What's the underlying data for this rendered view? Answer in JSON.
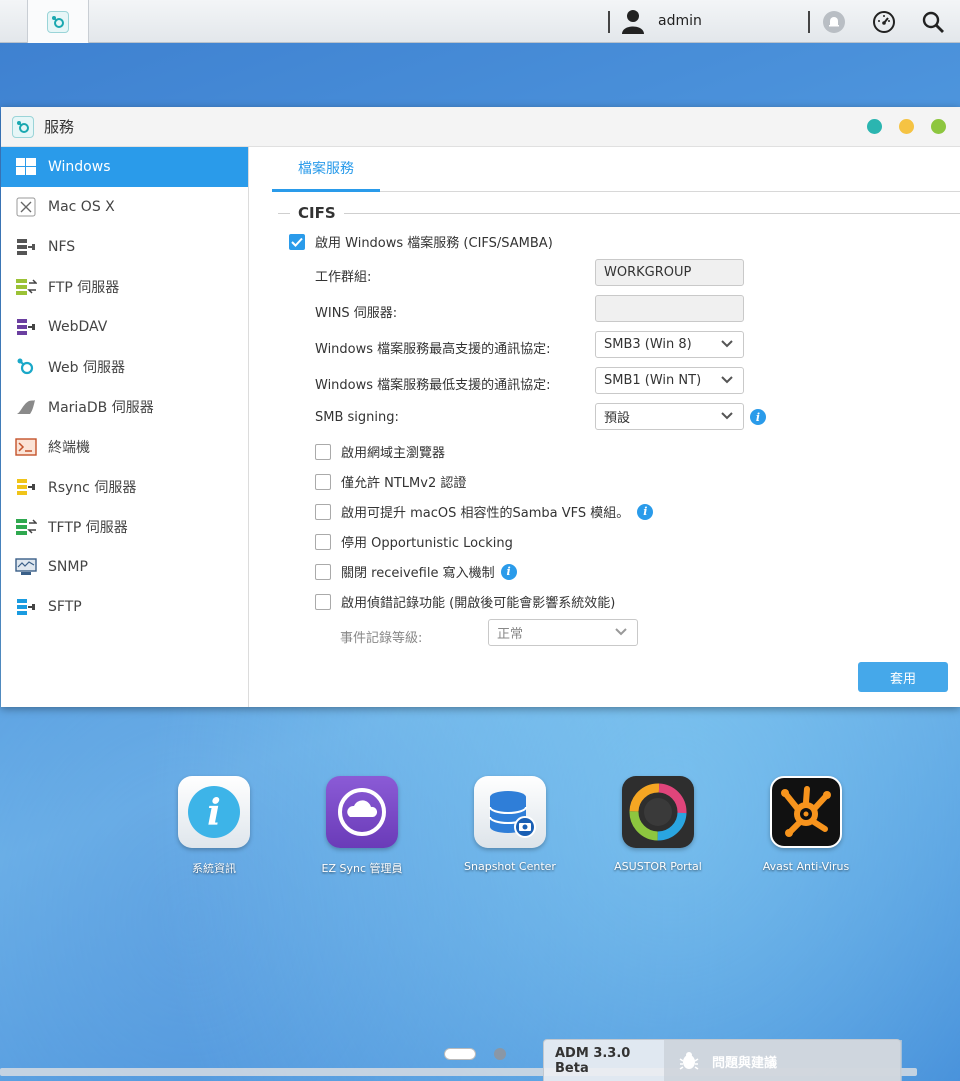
{
  "topbar": {
    "user_name": "admin",
    "icons": [
      "app-logo-icon",
      "user-icon",
      "notification-bell-icon",
      "dashboard-icon",
      "search-icon"
    ]
  },
  "window": {
    "title": "服務",
    "controls": {
      "colors": [
        "#2bb5b0",
        "#f5c343",
        "#8dc63f"
      ]
    }
  },
  "sidebar": {
    "items": [
      {
        "label": "Windows",
        "icon": "windows-icon",
        "active": true
      },
      {
        "label": "Mac OS X",
        "icon": "mac-os-x-icon"
      },
      {
        "label": "NFS",
        "icon": "nfs-icon"
      },
      {
        "label": "FTP 伺服器",
        "icon": "ftp-server-icon"
      },
      {
        "label": "WebDAV",
        "icon": "webdav-icon"
      },
      {
        "label": "Web 伺服器",
        "icon": "web-server-icon"
      },
      {
        "label": "MariaDB 伺服器",
        "icon": "mariadb-icon"
      },
      {
        "label": "終端機",
        "icon": "terminal-icon"
      },
      {
        "label": "Rsync 伺服器",
        "icon": "rsync-icon"
      },
      {
        "label": "TFTP 伺服器",
        "icon": "tftp-icon"
      },
      {
        "label": "SNMP",
        "icon": "snmp-icon"
      },
      {
        "label": "SFTP",
        "icon": "sftp-icon"
      }
    ]
  },
  "main": {
    "tab": "檔案服務",
    "section": "CIFS",
    "enable_label": "啟用 Windows 檔案服務 (CIFS/SAMBA)",
    "workgroup_label": "工作群組:",
    "workgroup_value": "WORKGROUP",
    "wins_label": "WINS 伺服器:",
    "wins_value": "",
    "max_proto_label": "Windows 檔案服務最高支援的通訊協定:",
    "max_proto_value": "SMB3 (Win 8)",
    "min_proto_label": "Windows 檔案服務最低支援的通訊協定:",
    "min_proto_value": "SMB1 (Win NT)",
    "smb_signing_label": "SMB signing:",
    "smb_signing_value": "預設",
    "options": [
      {
        "label": "啟用網域主瀏覽器",
        "checked": false
      },
      {
        "label": "僅允許 NTLMv2 認證",
        "checked": false
      },
      {
        "label": "啟用可提升 macOS 相容性的Samba VFS 模組。",
        "checked": false,
        "info": true
      },
      {
        "label": "停用 Opportunistic Locking",
        "checked": false
      },
      {
        "label": "關閉 receivefile 寫入機制",
        "checked": false,
        "info": true
      },
      {
        "label": "啟用偵錯記錄功能 (開啟後可能會影響系統效能)",
        "checked": false
      }
    ],
    "log_level_label": "事件記錄等級:",
    "log_level_value": "正常",
    "apply_label": "套用"
  },
  "desktop": {
    "apps": [
      {
        "label": "系統資訊",
        "icon": "system-info-icon"
      },
      {
        "label": "EZ Sync 管理員",
        "icon": "ez-sync-icon"
      },
      {
        "label": "Snapshot Center",
        "icon": "snapshot-center-icon"
      },
      {
        "label": "ASUSTOR Portal",
        "icon": "asustor-portal-icon"
      },
      {
        "label": "Avast Anti-Virus",
        "icon": "avast-icon"
      }
    ]
  },
  "bottom": {
    "version": "ADM 3.3.0 Beta",
    "feedback": "問題與建議"
  }
}
